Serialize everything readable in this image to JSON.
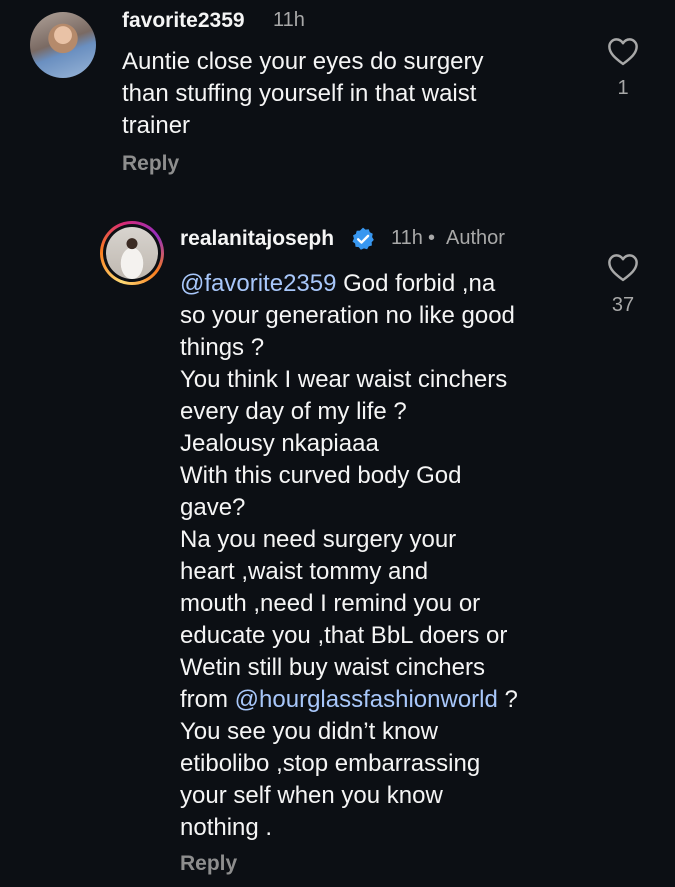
{
  "comments": [
    {
      "username": "favorite2359",
      "time": "11h",
      "text": "Auntie close your eyes do surgery\nthan stuffing yourself in that waist\ntrainer",
      "reply_label": "Reply",
      "like_count": "1"
    },
    {
      "username": "realanitajoseph",
      "verified": true,
      "time": "11h",
      "separator": "•",
      "author_label": "Author",
      "mention1": "@favorite2359",
      "text_part1": " God forbid ,na\nso your generation no like good\nthings ?\nYou think I wear waist cinchers\nevery day of my life ?\nJealousy nkapiaaa\nWith this curved body God\ngave?\nNa you need surgery  your\nheart ,waist tommy and\nmouth ,need  I remind you or\neducate you ,that BbL doers or\nWetin still buy waist cinchers\nfrom ",
      "mention2": "@hourglassfashionworld",
      "text_part2": " ?\nYou see you didn’t know\netibolibo ,stop embarrassing\nyour self when you know\nnothing .",
      "reply_label": "Reply",
      "like_count": "37"
    }
  ],
  "colors": {
    "background": "#0c0f14",
    "text": "#f5f5f5",
    "muted": "#a8a8a8",
    "mention": "#a8c7fa",
    "verified": "#3897f0"
  },
  "icons": [
    "heart-outline-icon",
    "verified-badge-icon"
  ]
}
